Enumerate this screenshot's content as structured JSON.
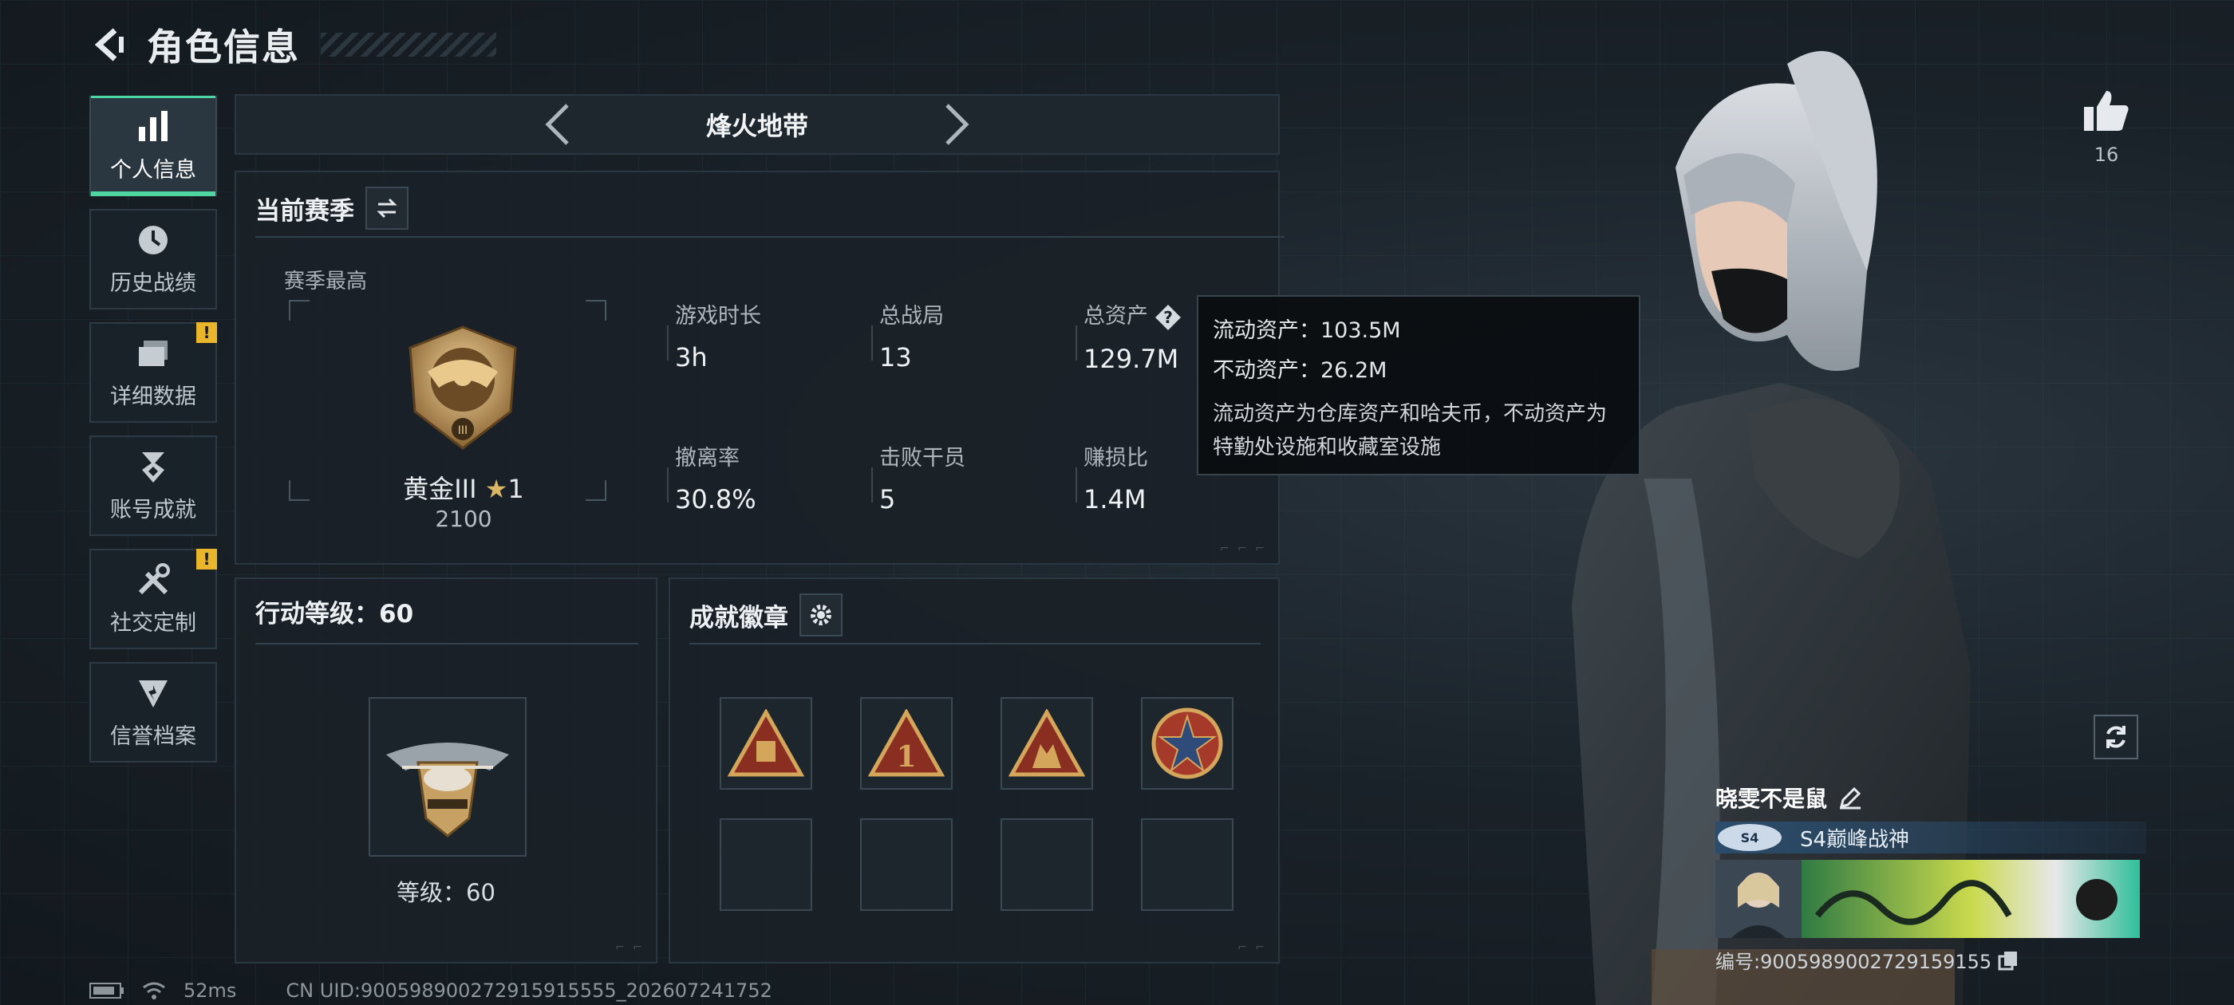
{
  "header": {
    "title": "角色信息"
  },
  "sidebar": {
    "items": [
      {
        "label": "个人信息",
        "icon": "bar-chart-icon",
        "active": true
      },
      {
        "label": "历史战绩",
        "icon": "clock-icon"
      },
      {
        "label": "详细数据",
        "icon": "folder-icon",
        "badge": "!"
      },
      {
        "label": "账号成就",
        "icon": "medal-icon"
      },
      {
        "label": "社交定制",
        "icon": "tools-icon",
        "badge": "!"
      },
      {
        "label": "信誉档案",
        "icon": "shield-icon"
      }
    ]
  },
  "mode": {
    "title": "烽火地带"
  },
  "season": {
    "title": "当前赛季",
    "best_label": "赛季最高",
    "rank_name": "黄金III",
    "rank_stars": "1",
    "rank_score": "2100",
    "stats": {
      "play_time": {
        "label": "游戏时长",
        "value": "3h"
      },
      "total_matches": {
        "label": "总战局",
        "value": "13"
      },
      "total_assets": {
        "label": "总资产",
        "value": "129.7M"
      },
      "extract_rate": {
        "label": "撤离率",
        "value": "30.8%"
      },
      "defeated_agents": {
        "label": "击败干员",
        "value": "5"
      },
      "profit_ratio": {
        "label": "赚损比",
        "value": "1.4M"
      }
    }
  },
  "tooltip": {
    "liquid": "流动资产：103.5M",
    "fixed": "不动资产：26.2M",
    "desc": "流动资产为仓库资产和哈夫币，不动资产为特勤处设施和收藏室设施"
  },
  "level": {
    "title": "行动等级：60",
    "caption": "等级：60"
  },
  "achievements": {
    "title": "成就徽章"
  },
  "likes": {
    "count": "16"
  },
  "profile": {
    "name": "晓雯不是鼠",
    "title": "S4巅峰战神",
    "id": "编号:9005989002729159155"
  },
  "status": {
    "ping": "52ms",
    "uid": "CN UID:900598900272915915555_202607241752"
  },
  "colors": {
    "accent": "#4fd6a0",
    "warning": "#e8b52b",
    "background": "#151c22"
  }
}
